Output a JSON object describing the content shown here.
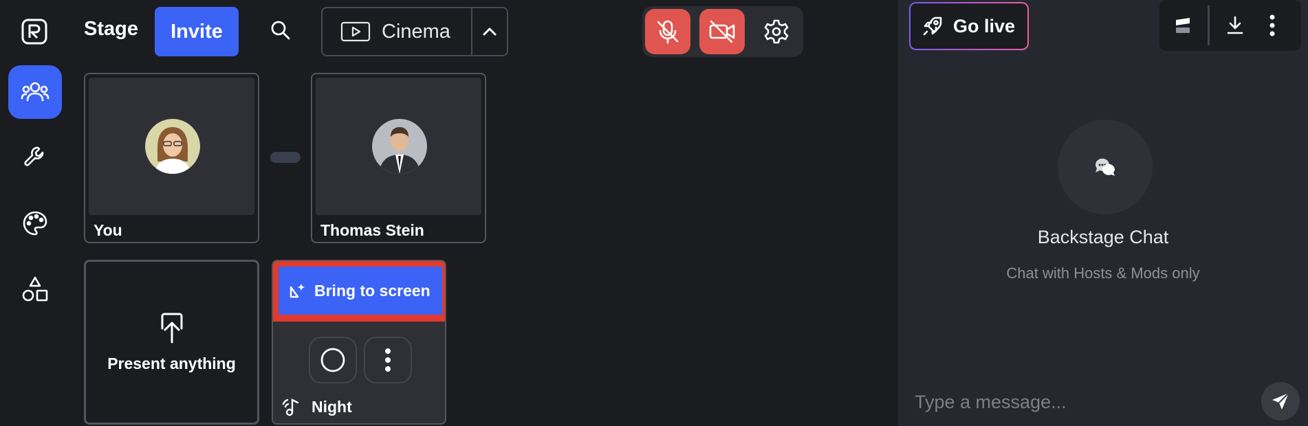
{
  "header": {
    "stage_label": "Stage",
    "invite_label": "Invite",
    "layout_label": "Cinema"
  },
  "rail": {
    "items": [
      "people-icon",
      "wrench-icon",
      "palette-icon",
      "shapes-icon"
    ],
    "active_index": 0
  },
  "participants": [
    {
      "name": "You"
    },
    {
      "name": "Thomas Stein"
    }
  ],
  "present": {
    "label": "Present anything"
  },
  "scene": {
    "bring_label": "Bring to screen",
    "name": "Night"
  },
  "right_panel": {
    "go_live_label": "Go live",
    "chat_title": "Backstage Chat",
    "chat_subtitle": "Chat with Hosts & Mods only",
    "input_placeholder": "Type a message..."
  },
  "colors": {
    "accent": "#3b63f5",
    "danger": "#e0554f",
    "highlight_border": "#e23a2c",
    "background": "#1b1c20",
    "panel": "#262830"
  }
}
